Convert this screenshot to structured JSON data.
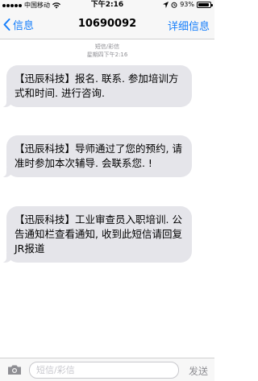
{
  "status_bar": {
    "carrier": "中国移动",
    "time": "下午2:16",
    "battery_percent_label": "93%",
    "battery_level": 0.93
  },
  "nav": {
    "back_label": "信息",
    "title": "10690092",
    "detail_label": "详细信息"
  },
  "thread": {
    "message_type": "短信/彩信",
    "timestamp": "星期四下午2:16"
  },
  "messages": [
    {
      "text": "【迅辰科技】报名. 联系. 参加培训方式和时间. 进行咨询."
    },
    {
      "text": "【迅辰科技】导师通过了您的预约, 请准时参加本次辅导. 会联系您. !"
    },
    {
      "text": "【迅辰科技】工业审查员入职培训. 公告通知栏查看通知, 收到此短信请回复JR报道"
    }
  ],
  "composer": {
    "placeholder": "短信/彩信",
    "value": "",
    "send_label": "发送"
  },
  "colors": {
    "accent": "#157efb",
    "bubble": "#e5e5ea"
  },
  "icons": [
    "signal-icon",
    "wifi-icon",
    "location-icon",
    "alarm-icon",
    "battery-icon",
    "back-chevron-icon",
    "camera-icon"
  ]
}
